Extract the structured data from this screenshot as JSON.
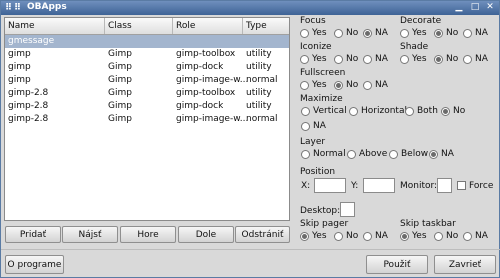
{
  "window": {
    "title": "OBApps",
    "icons": {
      "menu": "grid-icon",
      "close": "close-icon",
      "maximize": "maximize-icon",
      "minimize": "minimize-icon"
    }
  },
  "table": {
    "columns": [
      "Name",
      "Class",
      "Role",
      "Type"
    ],
    "rows": [
      {
        "name": "gmessage",
        "class": "",
        "role": "",
        "type": "",
        "selected": true
      },
      {
        "name": "gimp",
        "class": "Gimp",
        "role": "gimp-toolbox",
        "type": "utility"
      },
      {
        "name": "gimp",
        "class": "Gimp",
        "role": "gimp-dock",
        "type": "utility"
      },
      {
        "name": "gimp",
        "class": "Gimp",
        "role": "gimp-image-w...",
        "type": "normal"
      },
      {
        "name": "gimp-2.8",
        "class": "Gimp",
        "role": "gimp-toolbox",
        "type": "utility"
      },
      {
        "name": "gimp-2.8",
        "class": "Gimp",
        "role": "gimp-dock",
        "type": "utility"
      },
      {
        "name": "gimp-2.8",
        "class": "Gimp",
        "role": "gimp-image-w...",
        "type": "normal"
      }
    ],
    "buttons": {
      "add": "Pridať",
      "find": "Nájsť",
      "up": "Hore",
      "down": "Dole",
      "remove": "Odstrániť"
    }
  },
  "options": {
    "focus": {
      "label": "Focus",
      "yes": "Yes",
      "no": "No",
      "na": "NA",
      "selected": "na"
    },
    "decorate": {
      "label": "Decorate",
      "yes": "Yes",
      "no": "No",
      "na": "NA",
      "selected": "no"
    },
    "iconize": {
      "label": "Iconize",
      "yes": "Yes",
      "no": "No",
      "na": "NA",
      "selected": "none"
    },
    "shade": {
      "label": "Shade",
      "yes": "Yes",
      "no": "No",
      "na": "NA",
      "selected": "no"
    },
    "fullscreen": {
      "label": "Fullscreen",
      "yes": "Yes",
      "no": "No",
      "na": "NA",
      "selected": "no"
    },
    "maximize": {
      "label": "Maximize",
      "vertical": "Vertical",
      "horizontal": "Horizontal",
      "both": "Both",
      "no": "No",
      "na": "NA",
      "selected": "no"
    },
    "layer": {
      "label": "Layer",
      "normal": "Normal",
      "above": "Above",
      "below": "Below",
      "na": "NA",
      "selected": "na"
    },
    "position": {
      "label": "Position",
      "x_label": "X:",
      "y_label": "Y:",
      "monitor_label": "Monitor:",
      "force_label": "Force",
      "x_value": "",
      "y_value": "",
      "monitor_value": ""
    },
    "desktop": {
      "label": "Desktop:",
      "value": ""
    },
    "skip_pager": {
      "label": "Skip pager",
      "yes": "Yes",
      "no": "No",
      "na": "NA",
      "selected": "yes"
    },
    "skip_taskbar": {
      "label": "Skip taskbar",
      "yes": "Yes",
      "no": "No",
      "na": "NA",
      "selected": "yes"
    }
  },
  "footer": {
    "about": "O programe",
    "apply": "Použiť",
    "close": "Zavrieť"
  }
}
